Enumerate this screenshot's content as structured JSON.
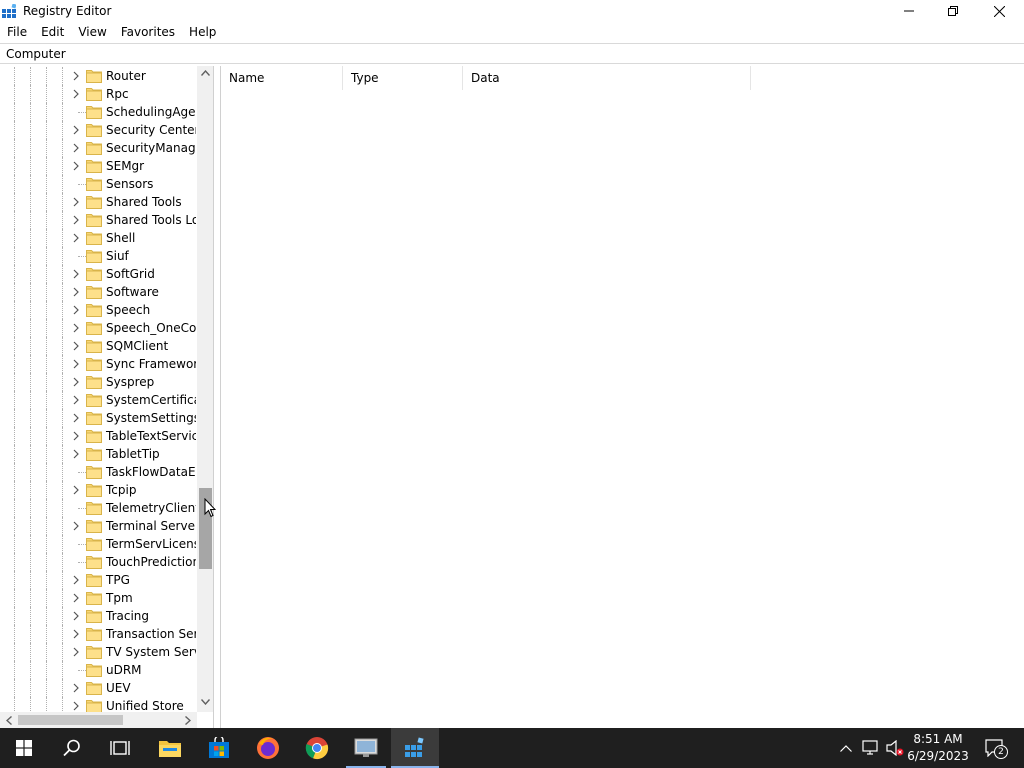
{
  "window": {
    "title": "Registry Editor"
  },
  "menu": [
    "File",
    "Edit",
    "View",
    "Favorites",
    "Help"
  ],
  "address": {
    "value": "Computer"
  },
  "tree": {
    "items": [
      {
        "label": "Router",
        "expandable": true
      },
      {
        "label": "Rpc",
        "expandable": true
      },
      {
        "label": "SchedulingAgent",
        "expandable": false
      },
      {
        "label": "Security Center",
        "expandable": true
      },
      {
        "label": "SecurityManager",
        "expandable": true
      },
      {
        "label": "SEMgr",
        "expandable": true
      },
      {
        "label": "Sensors",
        "expandable": false
      },
      {
        "label": "Shared Tools",
        "expandable": true
      },
      {
        "label": "Shared Tools Loca",
        "expandable": true
      },
      {
        "label": "Shell",
        "expandable": true
      },
      {
        "label": "Siuf",
        "expandable": false
      },
      {
        "label": "SoftGrid",
        "expandable": true
      },
      {
        "label": "Software",
        "expandable": true
      },
      {
        "label": "Speech",
        "expandable": true
      },
      {
        "label": "Speech_OneCore",
        "expandable": true
      },
      {
        "label": "SQMClient",
        "expandable": true
      },
      {
        "label": "Sync Framework",
        "expandable": true
      },
      {
        "label": "Sysprep",
        "expandable": true
      },
      {
        "label": "SystemCertificate",
        "expandable": true
      },
      {
        "label": "SystemSettings",
        "expandable": true
      },
      {
        "label": "TableTextService",
        "expandable": true
      },
      {
        "label": "TabletTip",
        "expandable": true
      },
      {
        "label": "TaskFlowDataEng",
        "expandable": false
      },
      {
        "label": "Tcpip",
        "expandable": true
      },
      {
        "label": "TelemetryClient",
        "expandable": false
      },
      {
        "label": "Terminal Server C",
        "expandable": true
      },
      {
        "label": "TermServLicensin",
        "expandable": false
      },
      {
        "label": "TouchPrediction",
        "expandable": false
      },
      {
        "label": "TPG",
        "expandable": true
      },
      {
        "label": "Tpm",
        "expandable": true
      },
      {
        "label": "Tracing",
        "expandable": true
      },
      {
        "label": "Transaction Serve",
        "expandable": true
      },
      {
        "label": "TV System Service",
        "expandable": true
      },
      {
        "label": "uDRM",
        "expandable": false
      },
      {
        "label": "UEV",
        "expandable": true
      },
      {
        "label": "Unified Store",
        "expandable": true
      }
    ]
  },
  "list": {
    "columns": [
      "Name",
      "Type",
      "Data"
    ]
  },
  "taskbar": {
    "apps": [
      "start-icon",
      "search-icon",
      "task-view-icon",
      "file-explorer-icon",
      "store-icon",
      "firefox-icon",
      "chrome-icon",
      "remote-desktop-icon",
      "regedit-icon"
    ],
    "clock_time": "8:51 AM",
    "clock_date": "6/29/2023",
    "notification_count": "2"
  },
  "colors": {
    "accent": "#0078d7",
    "folder": "#f8d775",
    "taskbar": "#1f1f1f"
  }
}
